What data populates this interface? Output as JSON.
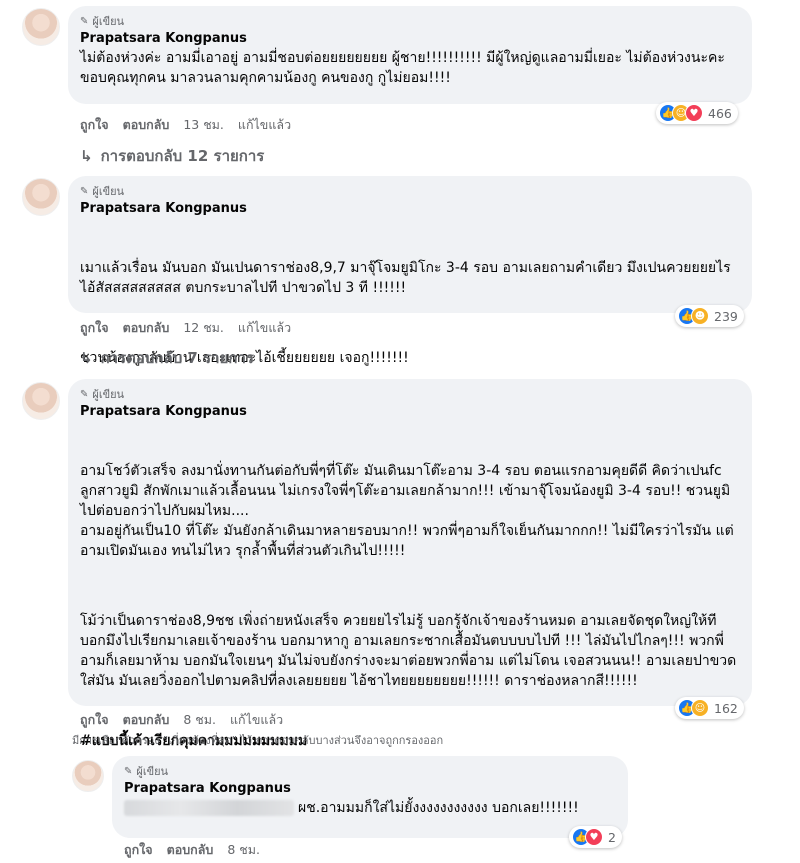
{
  "badge_label": "ผู้เขียน",
  "actions": {
    "like": "ถูกใจ",
    "reply": "ตอบกลับ",
    "edited": "แก้ไขแล้ว"
  },
  "comments": [
    {
      "author": "Prapatsara Kongpanus",
      "paragraphs": [
        "ไม่ต้องห่วงค่ะ อามมี่เอาอยู่ อามมี่ชอบต่อยยยยยยยย ผู้ชาย!!!!!!!!!! มีผู้ใหญ่ดูแลอามมี่เยอะ ไม่ต้องห่วงนะคะ ขอบคุณทุกคน มาลวนลามคุกคามน้องกู คนของกู กูไม่ยอม!!!!"
      ],
      "time": "13 ชม.",
      "reaction_count": "466",
      "replies": "การตอบกลับ 12 รายการ"
    },
    {
      "author": "Prapatsara Kongpanus",
      "paragraphs": [
        "เมาแล้วเรื่อน มันบอก มันเปนดาราช่อง8,9,7 มาจุ๊โจมยูมิโกะ 3-4 รอบ อามเลยถามคำเดียว มึงเปนควยยยยไร ไอ้สัสสสสสสสสส ตบกระบาลไปที ปาขวดไป 3 ที !!!!!!",
        "ชวนน้องกูกลับบ้าน เลอะเทอะไอ้เชี้ยยยยยย เจอกู!!!!!!!"
      ],
      "time": "12 ชม.",
      "reaction_count": "239",
      "replies": "การตอบกลับ 7 รายการ"
    },
    {
      "author": "Prapatsara Kongpanus",
      "paragraphs": [
        "อามโชว์ตัวเสร็จ ลงมานั่งทานกันต่อกับพี่ๆที่โต๊ะ มันเดินมาโต๊ะอาม 3-4 รอบ ตอนแรกอามคุยดีดี คิดว่าเปนfc ลูกสาวยูมิ สักพักเมาแล้วเลื้อนนน ไม่เกรงใจพี่ๆโต๊ะอามเลยกล้ามาก!!! เข้ามาจุ๊โจมน้องยูมิ 3-4 รอบ!! ชวนยูมิไปต่อบอกว่าไปกับผมไหม....\nอามอยู่กันเป็น10 ที่โต๊ะ มันยังกล้าเดินมาหลายรอบมาก!! พวกพี่ๆอามก็ใจเย็นกันมากกก!! ไม่มีใครว่าไรมัน แต่อามเปิดมันเอง ทนไม่ไหว รุกล้ำพื้นที่ส่วนตัวเกินไป!!!!!",
        "โม้ว่าเป็นดาราช่อง8,9ชช เพิ่งถ่ายหนังเสร็จ ควยยยไรไม่รู้ บอกรู้จักเจ้าของร้านหมด อามเลยจัดชุดใหญ่ให้ที บอกมึงไปเรียกมาเลยเจ้าของร้าน บอกมาหากู อามเลยกระชากเสื้อมันตบบบบไปที !!! ไล่มันไปไกลๆ!!! พวกพี่อามก็เลยมาห้าม บอกมันใจเยนๆ มันไม่จบยังกร่างจะมาต่อยพวกพี่อาม แต่ไม่โดน เจอสวนนน!! อามเลยปาขวดใส่มัน มันเลยวิ่งออกไปตามคลิปที่ลงเลยยยยย ไอ้ชาไทยยยยยยยย!!!!!! ดาราช่องหลากสี!!!!!!"
      ],
      "hashtag": "#แบบนี้เค้าเรียกคุมคามมมมมมมมมม",
      "time": "8 ชม.",
      "reaction_count": "162",
      "filter_note": "มีการเลือกตัวกรอง \"เกี่ยวข้องที่สุด\" ไว้ การตอบกลับบางส่วนจึงอาจถูกกรองออก"
    },
    {
      "author": "Prapatsara Kongpanus",
      "text": "ผช.อามมมก็ใส่ไม่ยั้งงงงงงงงงงง บอกเลย!!!!!!!",
      "time": "8 ชม.",
      "reaction_count": "2"
    }
  ]
}
